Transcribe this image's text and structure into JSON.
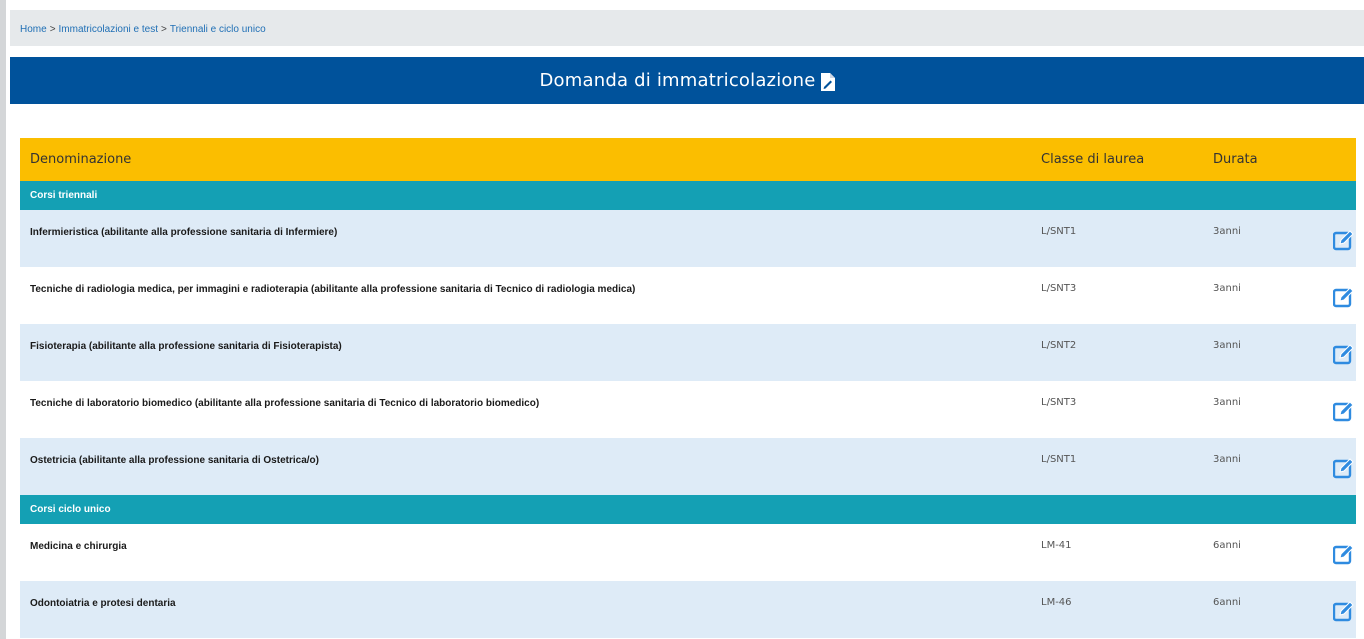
{
  "breadcrumb": {
    "items": [
      "Home",
      "Immatricolazioni e test",
      "Triennali e ciclo unico"
    ],
    "separator": ">"
  },
  "header": {
    "title": "Domanda di immatricolazione",
    "icon": "file-signature-icon"
  },
  "table": {
    "columns": {
      "name": "Denominazione",
      "class": "Classe di laurea",
      "duration": "Durata"
    },
    "groups": [
      {
        "label": "Corsi triennali",
        "rows": [
          {
            "name": "Infermieristica (abilitante alla professione sanitaria di Infermiere)",
            "class": "L/SNT1",
            "duration": "3anni"
          },
          {
            "name": "Tecniche di radiologia medica, per immagini e radioterapia (abilitante alla professione sanitaria di Tecnico di radiologia medica)",
            "class": "L/SNT3",
            "duration": "3anni"
          },
          {
            "name": "Fisioterapia (abilitante alla professione sanitaria di Fisioterapista)",
            "class": "L/SNT2",
            "duration": "3anni"
          },
          {
            "name": "Tecniche di laboratorio biomedico (abilitante alla professione sanitaria di Tecnico di laboratorio biomedico)",
            "class": "L/SNT3",
            "duration": "3anni"
          },
          {
            "name": "Ostetricia (abilitante alla professione sanitaria di Ostetrica/o)",
            "class": "L/SNT1",
            "duration": "3anni"
          }
        ]
      },
      {
        "label": "Corsi ciclo unico",
        "rows": [
          {
            "name": "Medicina e chirurgia",
            "class": "LM-41",
            "duration": "6anni"
          },
          {
            "name": "Odontoiatria e protesi dentaria",
            "class": "LM-46",
            "duration": "6anni"
          }
        ]
      }
    ],
    "action_icon": "edit-icon"
  },
  "colors": {
    "header_bg": "#00529b",
    "table_header_bg": "#fbbe00",
    "group_bg": "#14a0b4",
    "row_alt_bg": "#deebf7",
    "link": "#1f6fb5",
    "edit_icon": "#2f8be0"
  }
}
